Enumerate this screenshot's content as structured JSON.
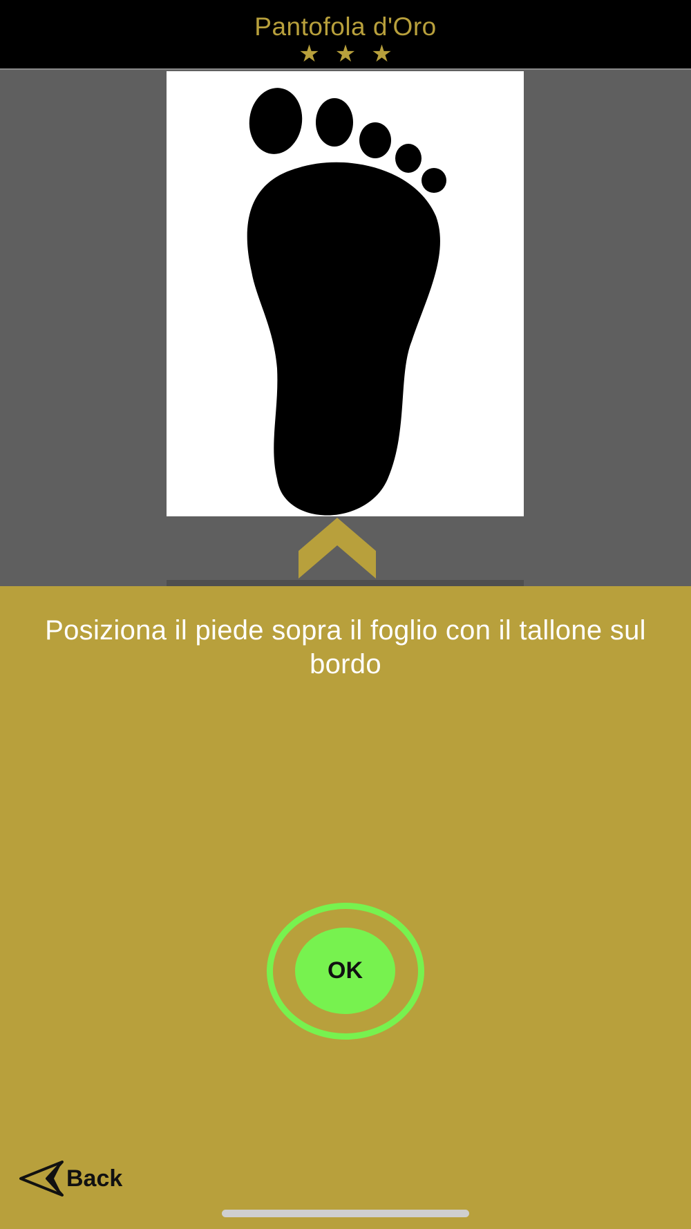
{
  "header": {
    "title": "Pantofola d'Oro",
    "stars": "★★★"
  },
  "instruction": {
    "text": "Posiziona il piede sopra il foglio con il tallone sul bordo"
  },
  "ok_button": {
    "label": "OK"
  },
  "back_button": {
    "label": "Back"
  },
  "icons": {
    "foot": "foot-icon",
    "chevron": "chevron-up-icon",
    "back": "back-arrow-icon"
  },
  "colors": {
    "brand_gold": "#b8a03c",
    "header_bg": "#000000",
    "camera_bg": "#5f5f5f",
    "ok_green": "#77f24f",
    "text_white": "#ffffff"
  }
}
